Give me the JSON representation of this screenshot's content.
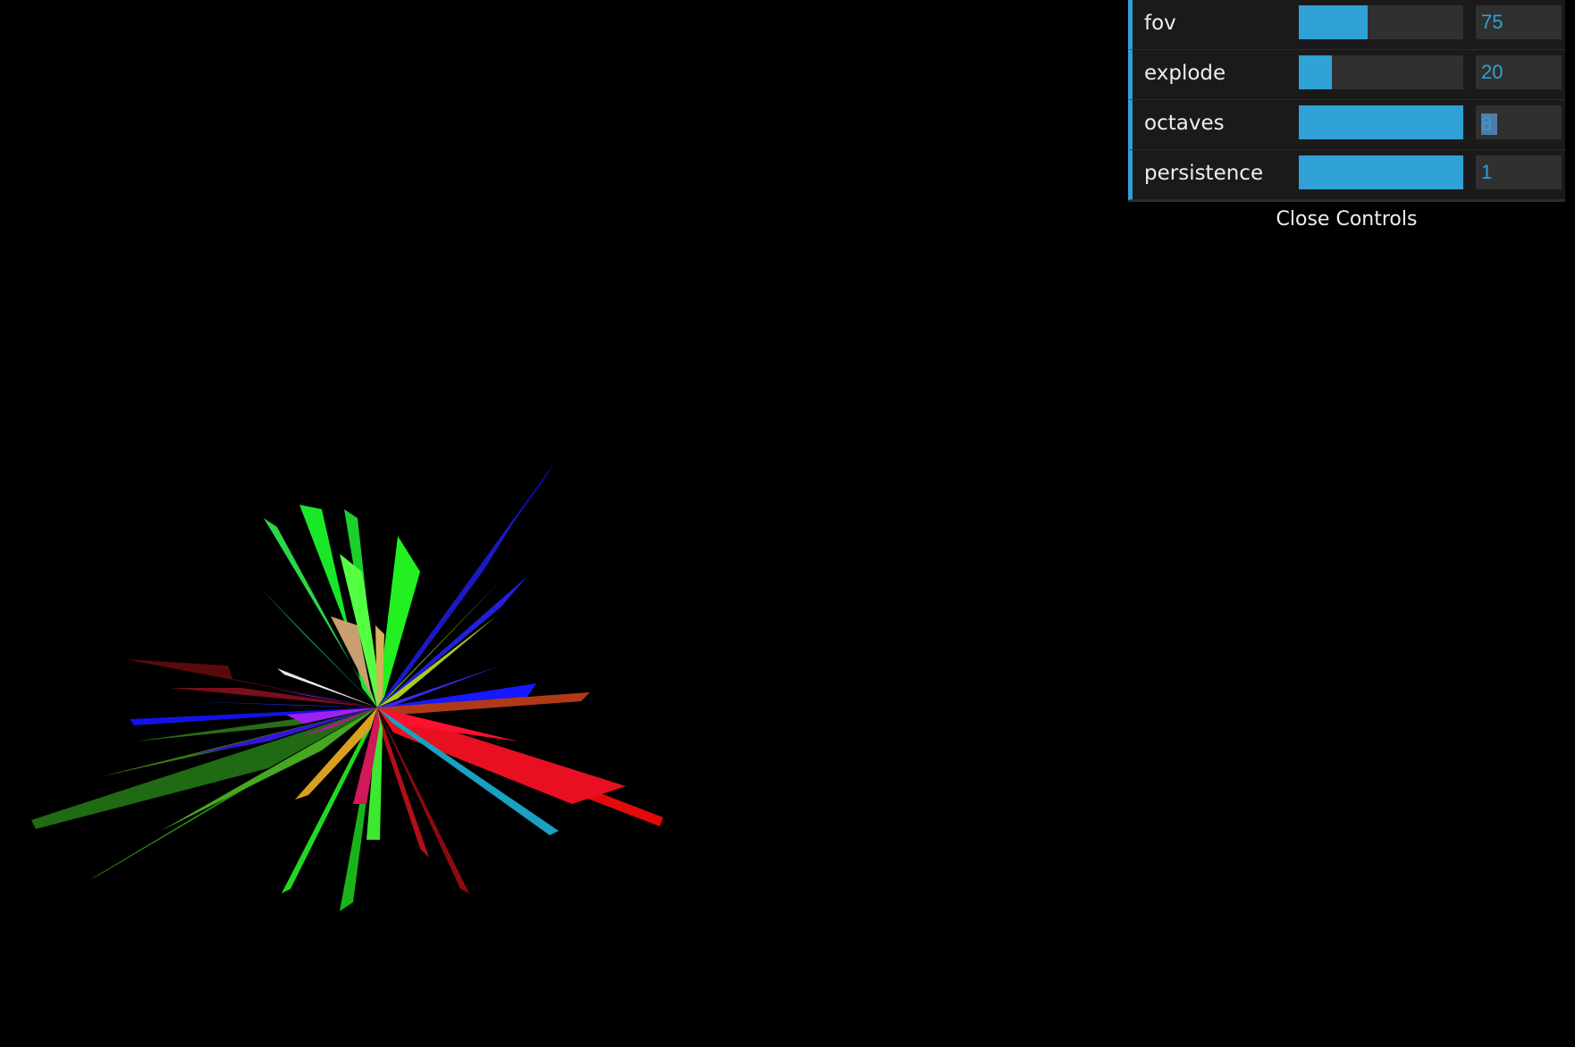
{
  "controls": [
    {
      "label": "fov",
      "value": "75",
      "fill": 0.42
    },
    {
      "label": "explode",
      "value": "20",
      "fill": 0.2
    },
    {
      "label": "octaves",
      "value": "8",
      "fill": 1.0,
      "selected": true
    },
    {
      "label": "persistence",
      "value": "1",
      "fill": 1.0
    }
  ],
  "close_label": "Close Controls",
  "colors": {
    "accent": "#2fa1d6",
    "panel": "#1a1a1a",
    "slider_bg": "#303030",
    "background": "#000000"
  }
}
